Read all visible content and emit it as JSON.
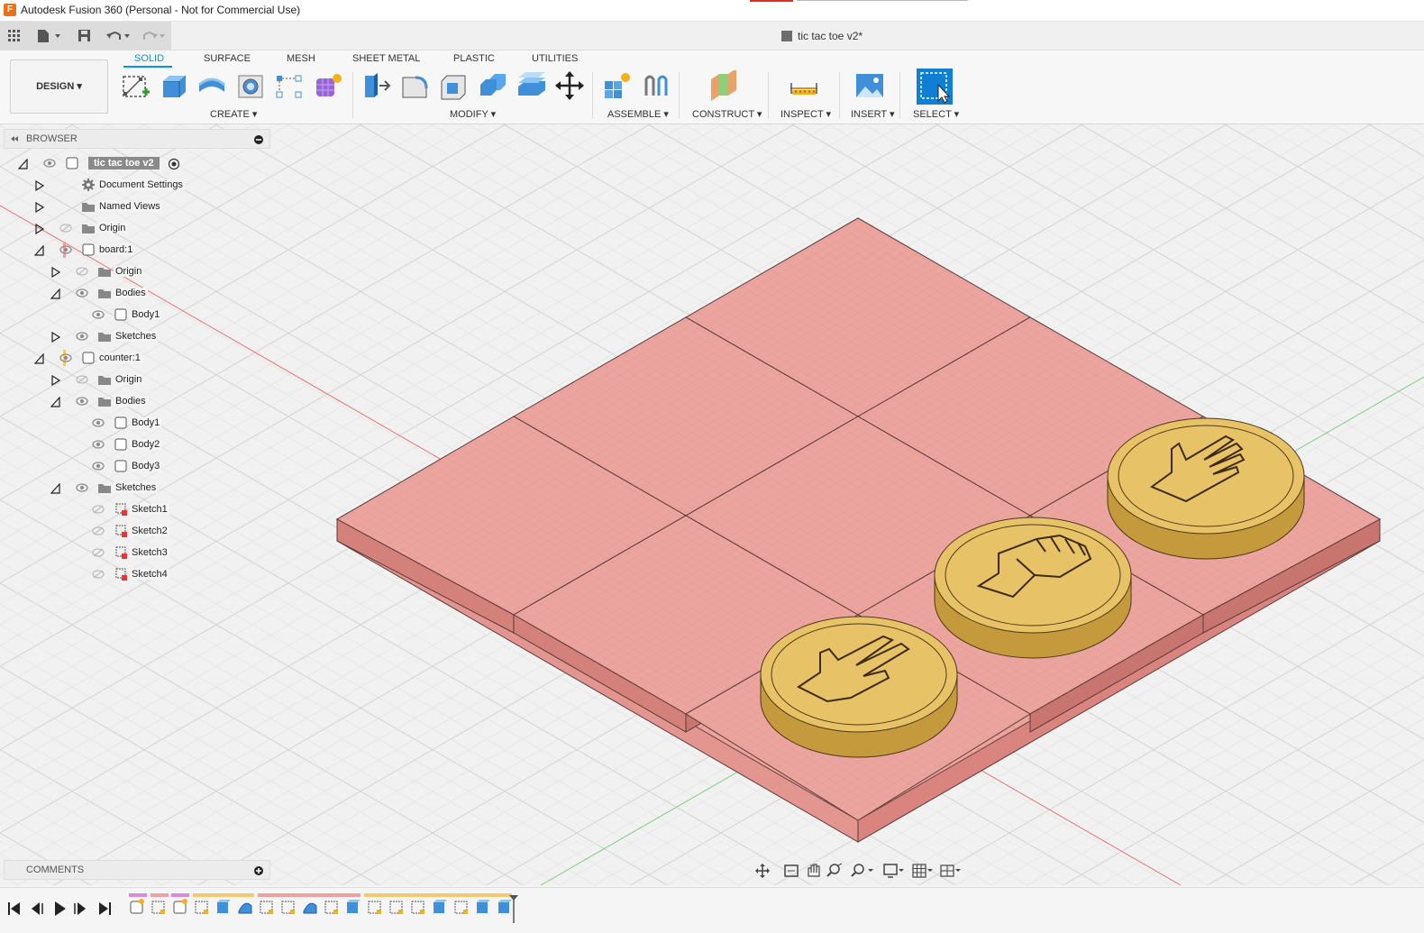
{
  "window": {
    "title": "Autodesk Fusion 360 (Personal - Not for Commercial Use)",
    "app_icon": "F"
  },
  "document_tab": "tic tac toe v2*",
  "workspace": "DESIGN",
  "tabs": [
    {
      "label": "SOLID",
      "active": true
    },
    {
      "label": "SURFACE"
    },
    {
      "label": "MESH"
    },
    {
      "label": "SHEET METAL"
    },
    {
      "label": "PLASTIC"
    },
    {
      "label": "UTILITIES"
    }
  ],
  "groups": {
    "create": "CREATE",
    "modify": "MODIFY",
    "assemble": "ASSEMBLE",
    "construct": "CONSTRUCT",
    "inspect": "INSPECT",
    "insert": "INSERT",
    "select": "SELECT"
  },
  "browser": {
    "title": "BROWSER",
    "root": "tic tac toe v2",
    "items": [
      {
        "label": "Document Settings"
      },
      {
        "label": "Named Views"
      },
      {
        "label": "Origin"
      },
      {
        "label": "board:1"
      },
      {
        "label": "Origin"
      },
      {
        "label": "Bodies"
      },
      {
        "label": "Body1"
      },
      {
        "label": "Sketches"
      },
      {
        "label": "counter:1"
      },
      {
        "label": "Origin"
      },
      {
        "label": "Bodies"
      },
      {
        "label": "Body1"
      },
      {
        "label": "Body2"
      },
      {
        "label": "Body3"
      },
      {
        "label": "Sketches"
      },
      {
        "label": "Sketch1"
      },
      {
        "label": "Sketch2"
      },
      {
        "label": "Sketch3"
      },
      {
        "label": "Sketch4"
      }
    ]
  },
  "comments": {
    "title": "COMMENTS"
  },
  "colors": {
    "accent": "#0696d7",
    "board": "#eca49e",
    "board_dark": "#d9847f",
    "counter": "#e8c267",
    "counter_dark": "#c49a3c",
    "grid": "#d8d8d8",
    "x_axis": "#e57373",
    "y_axis": "#7ccf7c"
  }
}
